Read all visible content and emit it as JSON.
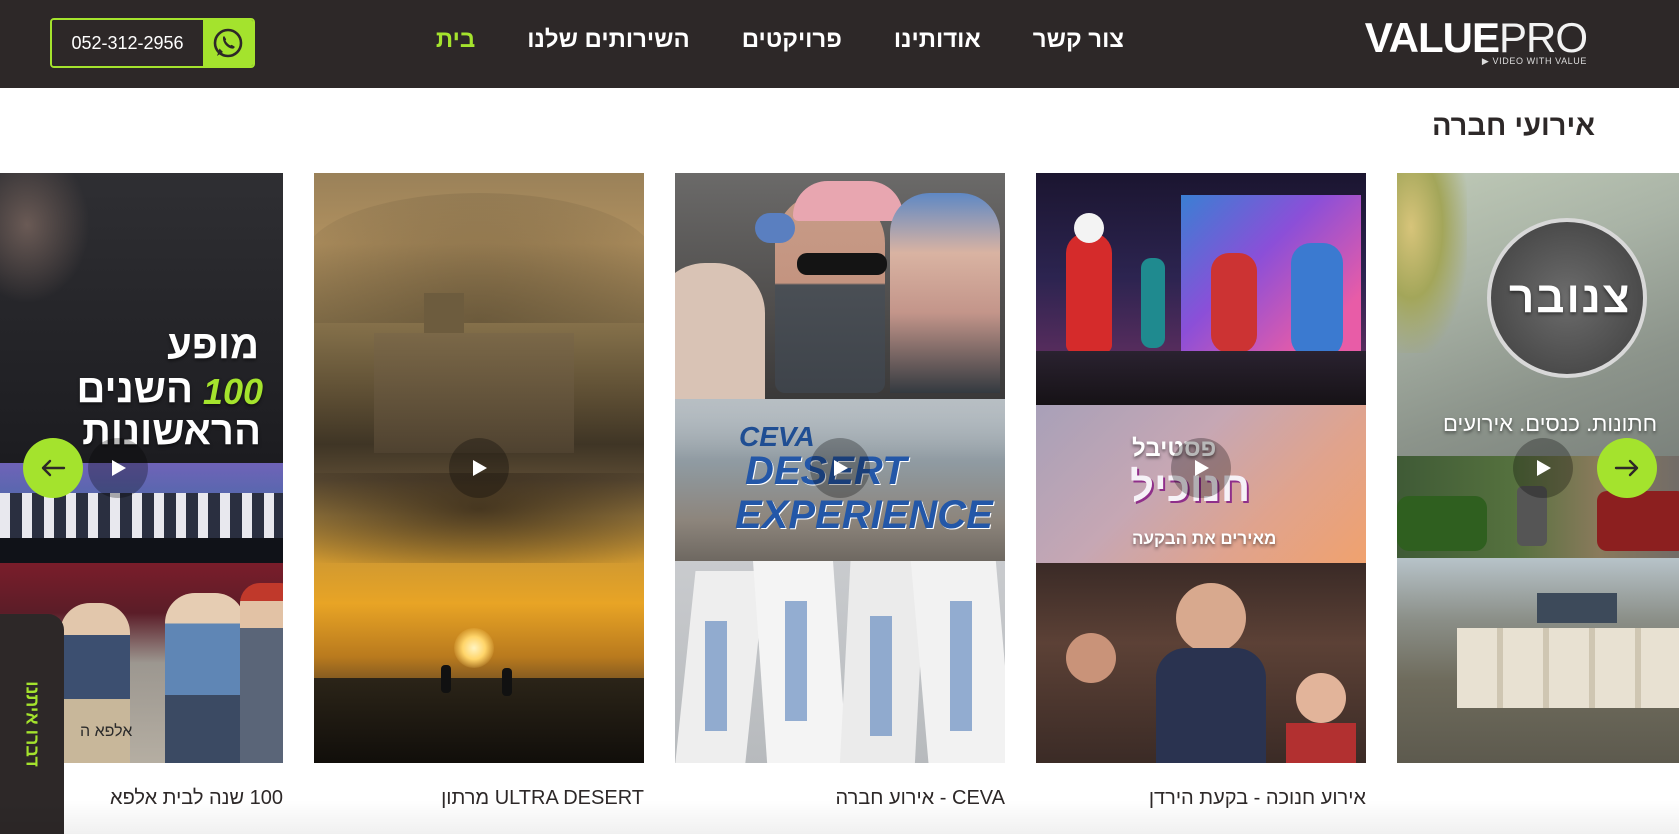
{
  "header": {
    "logo_bold": "VALUE",
    "logo_light": "PRO",
    "logo_tagline": "▶ VIDEO WITH VALUE",
    "nav": [
      {
        "label": "בית",
        "active": true
      },
      {
        "label": "השירותים שלנו",
        "active": false
      },
      {
        "label": "פרויקטים",
        "active": false
      },
      {
        "label": "אודותינו",
        "active": false
      },
      {
        "label": "צור קשר",
        "active": false
      }
    ],
    "phone": "052-312-2956",
    "whatsapp_icon": "whatsapp-icon"
  },
  "section": {
    "title": "אירועי חברה"
  },
  "cards": [
    {
      "caption": "",
      "overlay_top": "צנובר",
      "overlay_mid": "חתונות. כנסים. אירועים"
    },
    {
      "caption": "אירוע חנוכה - בקעת הירדן",
      "overlay_top": "פסטיבל",
      "overlay_main": "חנוכיל",
      "overlay_sub": "מאירים את הבקעה"
    },
    {
      "caption": "CEVA - אירוע חברה",
      "overlay_top": "CEVA",
      "overlay_main1": "DESERT",
      "overlay_main2": "EXPERIENCE"
    },
    {
      "caption": "ULTRA DESERT מרתון",
      "overlay": ""
    },
    {
      "caption": "100 שנה לבית אלפא",
      "overlay_l1": "מופע",
      "overlay_l2": "השנים",
      "overlay_num": "100",
      "overlay_l3": "הראשונות",
      "overlay_sign": "אלפא ה"
    }
  ],
  "side_tab": {
    "label": "דברו איתנו"
  },
  "colors": {
    "accent": "#a4e32d",
    "dark": "#2d2828",
    "white": "#ffffff"
  },
  "icons": {
    "prev": "arrow-left-icon",
    "next": "arrow-right-icon",
    "play": "play-icon"
  }
}
